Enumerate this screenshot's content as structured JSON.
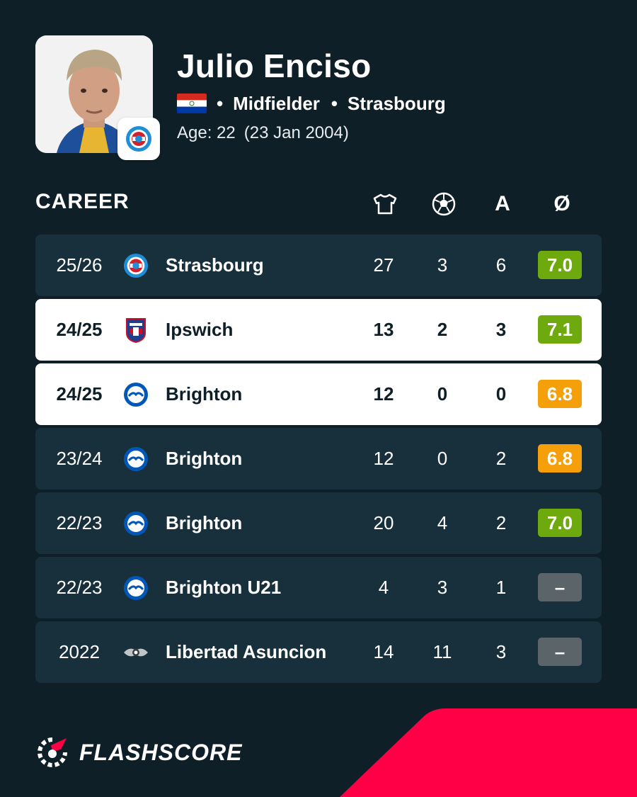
{
  "player": {
    "name": "Julio Enciso",
    "position": "Midfielder",
    "club": "Strasbourg",
    "age_label": "Age: 22",
    "birth_date": "(23 Jan 2004)",
    "photo_icon": "player-photo",
    "flag_icon": "paraguay-flag"
  },
  "career": {
    "title": "CAREER",
    "columns": [
      "appearances-jersey-icon",
      "goals-ball-icon",
      "A",
      "Ø"
    ],
    "rows": [
      {
        "season": "25/26",
        "team": "Strasbourg",
        "logo": "strasbourg-logo",
        "apps": "27",
        "goals": "3",
        "assists": "6",
        "rating": "7.0",
        "rating_color": "#6ea90e",
        "highlight": false
      },
      {
        "season": "24/25",
        "team": "Ipswich",
        "logo": "ipswich-logo",
        "apps": "13",
        "goals": "2",
        "assists": "3",
        "rating": "7.1",
        "rating_color": "#6ea90e",
        "highlight": true
      },
      {
        "season": "24/25",
        "team": "Brighton",
        "logo": "brighton-logo",
        "apps": "12",
        "goals": "0",
        "assists": "0",
        "rating": "6.8",
        "rating_color": "#f59f0b",
        "highlight": true
      },
      {
        "season": "23/24",
        "team": "Brighton",
        "logo": "brighton-logo",
        "apps": "12",
        "goals": "0",
        "assists": "2",
        "rating": "6.8",
        "rating_color": "#f59f0b",
        "highlight": false
      },
      {
        "season": "22/23",
        "team": "Brighton",
        "logo": "brighton-logo",
        "apps": "20",
        "goals": "4",
        "assists": "2",
        "rating": "7.0",
        "rating_color": "#6ea90e",
        "highlight": false
      },
      {
        "season": "22/23",
        "team": "Brighton U21",
        "logo": "brighton-logo",
        "apps": "4",
        "goals": "3",
        "assists": "1",
        "rating": "–",
        "rating_color": "#5a6469",
        "highlight": false
      },
      {
        "season": "2022",
        "team": "Libertad Asuncion",
        "logo": "libertad-logo",
        "apps": "14",
        "goals": "11",
        "assists": "3",
        "rating": "–",
        "rating_color": "#5a6469",
        "highlight": false
      }
    ]
  },
  "brand": {
    "name": "FLASHSCORE",
    "accent_color": "#ff0046"
  }
}
